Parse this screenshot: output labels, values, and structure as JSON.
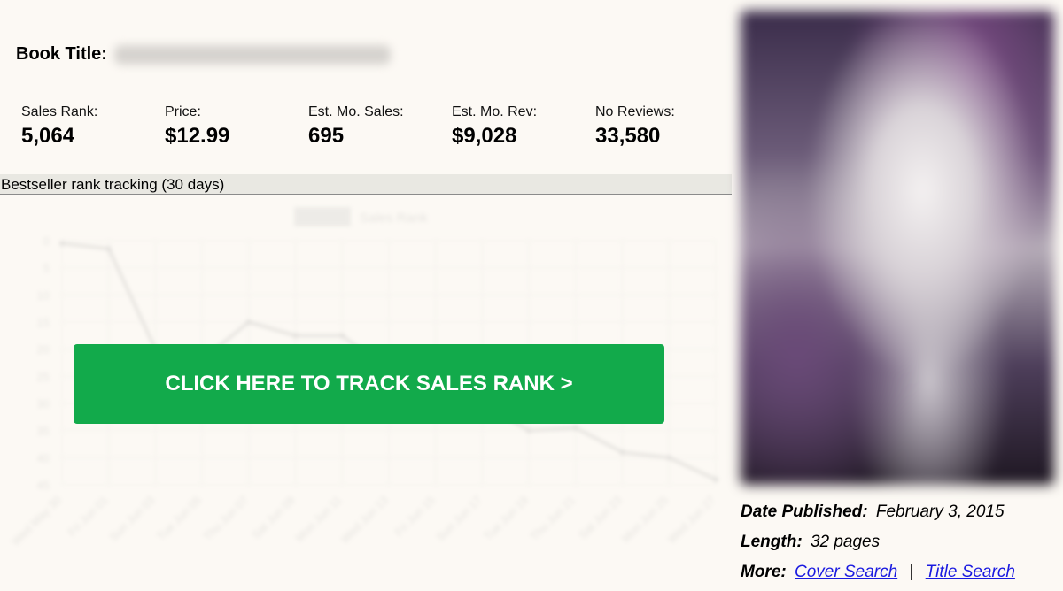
{
  "book": {
    "title_label": "Book Title:"
  },
  "stats": [
    {
      "label": "Sales Rank:",
      "value": "5,064"
    },
    {
      "label": "Price:",
      "value": "$12.99"
    },
    {
      "label": "Est. Mo. Sales:",
      "value": "695"
    },
    {
      "label": "Est. Mo. Rev:",
      "value": "$9,028"
    },
    {
      "label": "No Reviews:",
      "value": "33,580"
    }
  ],
  "tracking": {
    "heading": "Bestseller rank tracking (30 days)",
    "cta_label": "CLICK HERE TO TRACK SALES RANK >"
  },
  "chart_data": {
    "type": "line",
    "title": "",
    "legend": "Sales Rank",
    "yticks": [
      0,
      5,
      10,
      15,
      20,
      25,
      30,
      35,
      40,
      45
    ],
    "ylim": [
      0,
      45
    ],
    "y_inverted": true,
    "grid": true,
    "x": [
      "Wed May 30",
      "Fri Jun 01",
      "Sun Jun 03",
      "Tue Jun 05",
      "Thu Jun 07",
      "Sat Jun 09",
      "Mon Jun 11",
      "Wed Jun 13",
      "Fri Jun 15",
      "Sun Jun 17",
      "Tue Jun 19",
      "Thu Jun 21",
      "Sat Jun 23",
      "Mon Jun 25",
      "Wed Jun 27"
    ],
    "series": [
      {
        "name": "Sales Rank",
        "values": [
          0.5,
          1.5,
          20,
          22,
          15,
          17.5,
          17.5,
          24,
          27,
          30,
          35,
          34.5,
          39,
          40,
          44
        ]
      }
    ],
    "colors": {
      "line": "#888888",
      "grid": "#cfcfcf",
      "text": "#999999"
    }
  },
  "details": {
    "date_label": "Date Published:",
    "date_value": "February 3, 2015",
    "length_label": "Length:",
    "length_value": "32 pages",
    "more_label": "More:",
    "cover_search": "Cover Search",
    "separator": "|",
    "title_search": "Title Search"
  },
  "colors": {
    "cta": "#12aa4b",
    "link": "#1a1ae0",
    "background": "#fcf9f4"
  }
}
